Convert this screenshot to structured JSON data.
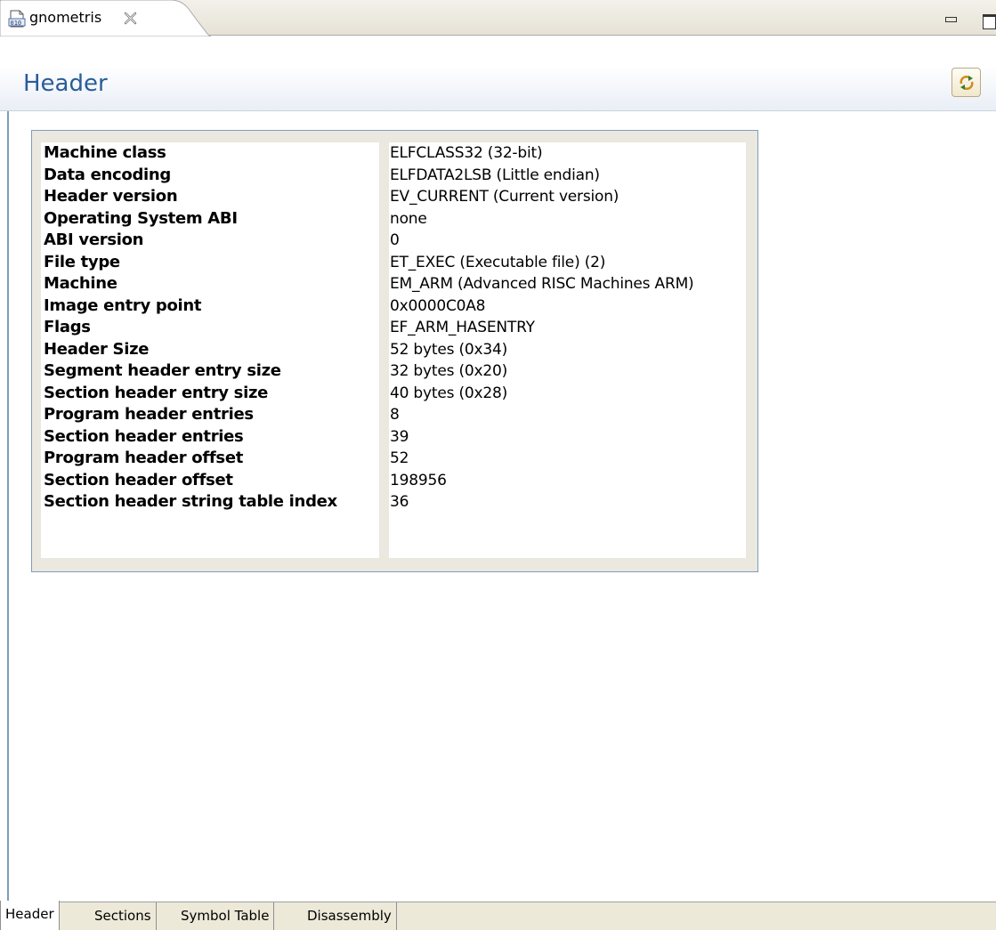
{
  "editor_tab": {
    "title": "gnometris",
    "file_icon": "binary-file-icon",
    "close_icon": "close-icon"
  },
  "view_controls": {
    "minimize_icon": "minimize-icon",
    "maximize_icon": "maximize-icon"
  },
  "form": {
    "title": "Header",
    "refresh_icon": "refresh-icon"
  },
  "header_table": {
    "rows": [
      {
        "name": "Machine class",
        "value": "ELFCLASS32 (32-bit)"
      },
      {
        "name": "Data encoding",
        "value": "ELFDATA2LSB (Little endian)"
      },
      {
        "name": "Header version",
        "value": "EV_CURRENT (Current version)"
      },
      {
        "name": "Operating System ABI",
        "value": "none"
      },
      {
        "name": "ABI version",
        "value": "0"
      },
      {
        "name": "File type",
        "value": "ET_EXEC (Executable file) (2)"
      },
      {
        "name": "Machine",
        "value": "EM_ARM (Advanced RISC Machines ARM)"
      },
      {
        "name": "Image entry point",
        "value": "0x0000C0A8"
      },
      {
        "name": "Flags",
        "value": "EF_ARM_HASENTRY"
      },
      {
        "name": "Header Size",
        "value": "52 bytes (0x34)"
      },
      {
        "name": "Segment header entry size",
        "value": "32 bytes (0x20)"
      },
      {
        "name": "Section header entry size",
        "value": "40 bytes (0x28)"
      },
      {
        "name": "Program header entries",
        "value": "8"
      },
      {
        "name": "Section header entries",
        "value": "39"
      },
      {
        "name": "Program header offset",
        "value": "52"
      },
      {
        "name": "Section header offset",
        "value": "198956"
      },
      {
        "name": "Section header string table index",
        "value": "36"
      }
    ]
  },
  "page_tabs": [
    {
      "label": "Header",
      "active": true
    },
    {
      "label": "Sections",
      "active": false
    },
    {
      "label": "Symbol Table",
      "active": false
    },
    {
      "label": "Disassembly",
      "active": false
    }
  ],
  "colors": {
    "title": "#2a5c9a",
    "border": "#7f9db9",
    "panel": "#ebe8e0"
  }
}
